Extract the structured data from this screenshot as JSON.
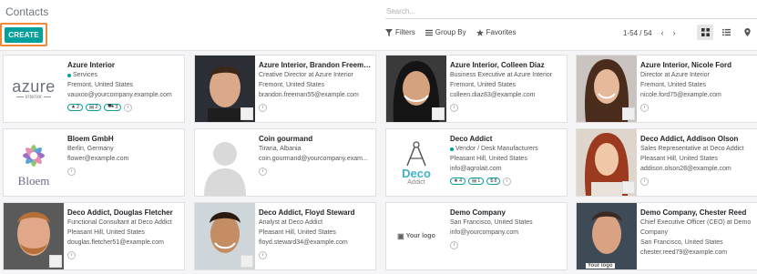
{
  "breadcrumb": "Contacts",
  "create_label": "CREATE",
  "search": {
    "placeholder": "Search..."
  },
  "filters": {
    "filters_label": "Filters",
    "groupby_label": "Group By",
    "favorites_label": "Favorites"
  },
  "pager": {
    "text": "1-54 / 54"
  },
  "cards": [
    {
      "name": "Azure Interior",
      "tag": "Services",
      "lines": [
        "Fremont, United States",
        "vauxoo@yourcompany.example.com"
      ],
      "badges": [
        "2",
        "2",
        "3"
      ],
      "logo_text": "azure",
      "logo_sub": "interior"
    },
    {
      "name": "Azure Interior, Brandon Freeman",
      "lines": [
        "Creative Director at Azure Interior",
        "Fremont, United States",
        "brandon.freeman55@example.com"
      ]
    },
    {
      "name": "Azure Interior, Colleen Diaz",
      "lines": [
        "Business Executive at Azure Interior",
        "Fremont, United States",
        "colleen.diaz83@example.com"
      ]
    },
    {
      "name": "Azure Interior, Nicole Ford",
      "lines": [
        "Director at Azure Interior",
        "Fremont, United States",
        "nicole.ford75@example.com"
      ]
    },
    {
      "name": "Bloem GmbH",
      "lines": [
        "Berlin, Germany",
        "flower@example.com"
      ],
      "logo_text": "Bloem"
    },
    {
      "name": "Coin gourmand",
      "lines": [
        "Tirana, Albania",
        "coin.gourmand@yourcompany.exam..."
      ]
    },
    {
      "name": "Deco Addict",
      "tag": "Vendor / Desk Manufacturers",
      "lines": [
        "Pleasant Hill, United States",
        "info@agrolait.com"
      ],
      "badges": [
        "4",
        "1",
        "8"
      ],
      "logo_text": "Deco",
      "logo_sub": "Addict"
    },
    {
      "name": "Deco Addict, Addison Olson",
      "lines": [
        "Sales Representative at Deco Addict",
        "Pleasant Hill, United States",
        "addison.olson28@example.com"
      ]
    },
    {
      "name": "Deco Addict, Douglas Fletcher",
      "lines": [
        "Functional Consultant at Deco Addict",
        "Pleasant Hill, United States",
        "douglas.fletcher51@example.com"
      ]
    },
    {
      "name": "Deco Addict, Floyd Steward",
      "lines": [
        "Analyst at Deco Addict",
        "Pleasant Hill, United States",
        "floyd.steward34@example.com"
      ]
    },
    {
      "name": "Demo Company",
      "lines": [
        "San Francisco, United States",
        "info@yourcompany.com"
      ],
      "logo_text": "Your logo"
    },
    {
      "name": "Demo Company, Chester Reed",
      "lines": [
        "Chief Executive Officer (CEO) at Demo",
        "Company",
        "San Francisco, United States",
        "chester.reed79@example.com"
      ],
      "logo_text": "Your logo"
    }
  ]
}
